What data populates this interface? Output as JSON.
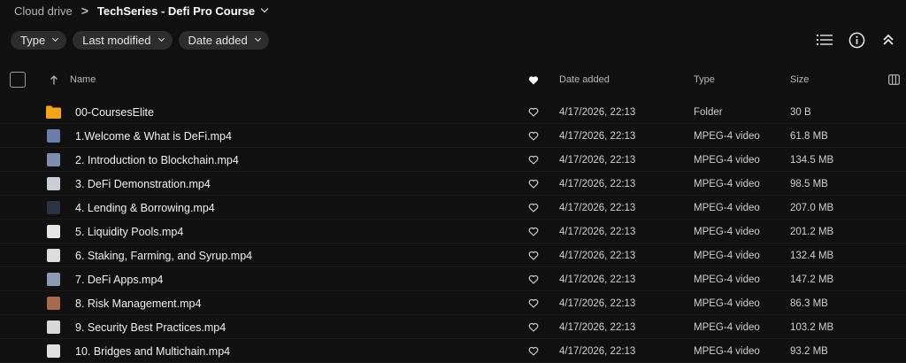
{
  "breadcrumb": {
    "root": "Cloud drive",
    "current": "TechSeries - Defi Pro Course"
  },
  "filters": [
    {
      "label": "Type"
    },
    {
      "label": "Last modified"
    },
    {
      "label": "Date added"
    }
  ],
  "toolbar": {
    "icons": [
      "list-view-icon",
      "info-icon",
      "collapse-icon"
    ]
  },
  "columns": {
    "name": "Name",
    "date_added": "Date added",
    "type": "Type",
    "size": "Size"
  },
  "files": [
    {
      "name": "00-CoursesElite",
      "date": "4/17/2026, 22:13",
      "type": "Folder",
      "size": "30 B",
      "kind": "folder"
    },
    {
      "name": "1.Welcome & What is DeFi.mp4",
      "date": "4/17/2026, 22:13",
      "type": "MPEG-4 video",
      "size": "61.8 MB",
      "kind": "video",
      "thumb": "#6a7ea8"
    },
    {
      "name": "2. Introduction to Blockchain.mp4",
      "date": "4/17/2026, 22:13",
      "type": "MPEG-4 video",
      "size": "134.5 MB",
      "kind": "video",
      "thumb": "#7d8fb0"
    },
    {
      "name": "3. DeFi Demonstration.mp4",
      "date": "4/17/2026, 22:13",
      "type": "MPEG-4 video",
      "size": "98.5 MB",
      "kind": "video",
      "thumb": "#c9cdd6"
    },
    {
      "name": "4. Lending & Borrowing.mp4",
      "date": "4/17/2026, 22:13",
      "type": "MPEG-4 video",
      "size": "207.0 MB",
      "kind": "video",
      "thumb": "#2c3346"
    },
    {
      "name": "5. Liquidity Pools.mp4",
      "date": "4/17/2026, 22:13",
      "type": "MPEG-4 video",
      "size": "201.2 MB",
      "kind": "video",
      "thumb": "#e6e6e6"
    },
    {
      "name": "6. Staking, Farming, and Syrup.mp4",
      "date": "4/17/2026, 22:13",
      "type": "MPEG-4 video",
      "size": "132.4 MB",
      "kind": "video",
      "thumb": "#dcdcdc"
    },
    {
      "name": "7. DeFi Apps.mp4",
      "date": "4/17/2026, 22:13",
      "type": "MPEG-4 video",
      "size": "147.2 MB",
      "kind": "video",
      "thumb": "#8d9ab5"
    },
    {
      "name": "8. Risk Management.mp4",
      "date": "4/17/2026, 22:13",
      "type": "MPEG-4 video",
      "size": "86.3 MB",
      "kind": "video",
      "thumb": "#a86a4c"
    },
    {
      "name": "9. Security Best Practices.mp4",
      "date": "4/17/2026, 22:13",
      "type": "MPEG-4 video",
      "size": "103.2 MB",
      "kind": "video",
      "thumb": "#d8d8d8"
    },
    {
      "name": "10. Bridges and Multichain.mp4",
      "date": "4/17/2026, 22:13",
      "type": "MPEG-4 video",
      "size": "93.2 MB",
      "kind": "video",
      "thumb": "#e0e0e0"
    }
  ],
  "colors": {
    "background": "#111111",
    "chip": "#2d2d2d",
    "folder": "#f2a516"
  }
}
